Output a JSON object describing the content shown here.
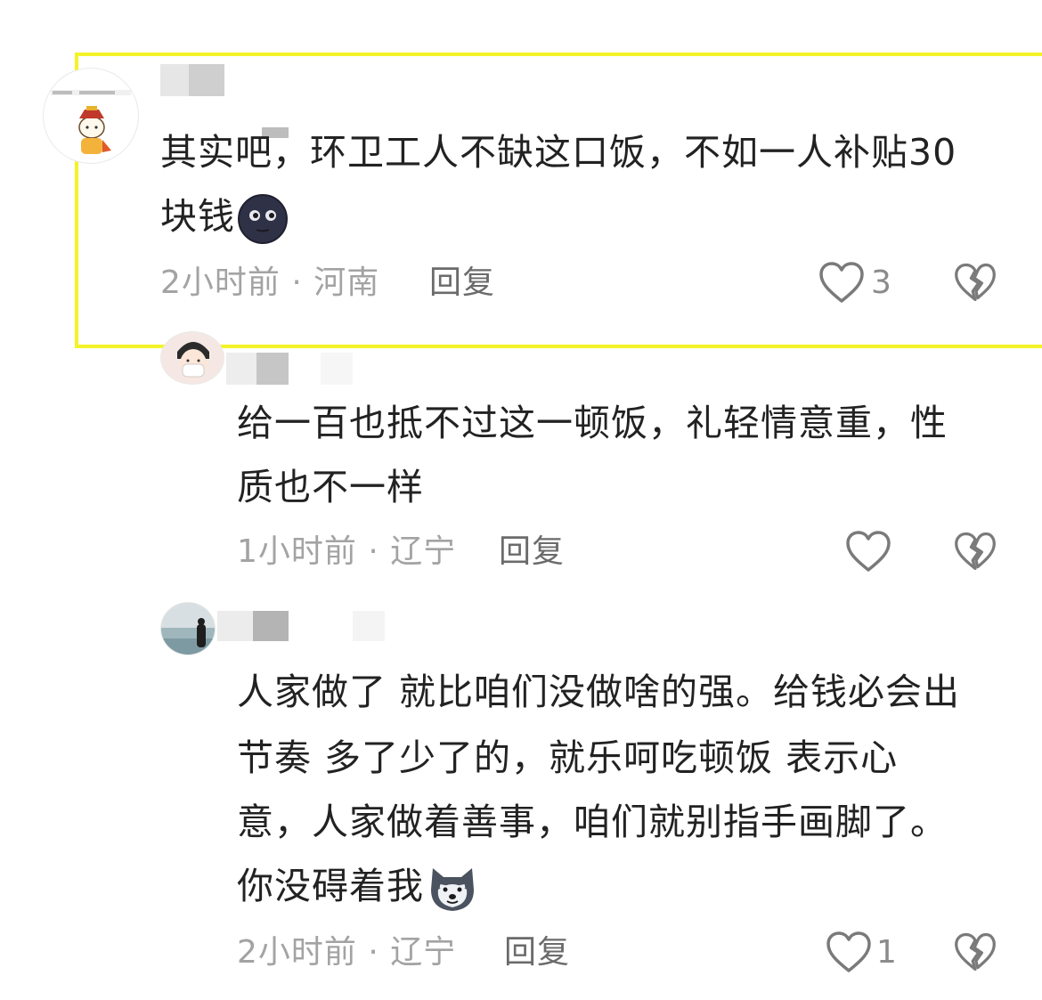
{
  "comments": [
    {
      "text_lines": [
        "其实吧，环卫工人不缺这口饭，不如一人补贴30",
        "块钱"
      ],
      "emoji": "new-moon-face-emoji",
      "time": "2小时前",
      "location": "河南",
      "reply_label": "回复",
      "likes": "3"
    },
    {
      "text_lines": [
        "给一百也抵不过这一顿饭，礼轻情意重，性",
        "质也不一样"
      ],
      "time": "1小时前",
      "location": "辽宁",
      "reply_label": "回复",
      "likes": ""
    },
    {
      "text_lines": [
        "人家做了 就比咱们没做啥的强。给钱必会出",
        "节奏 多了少了的，就乐呵吃顿饭 表示心",
        "意，人家做着善事，咱们就别指手画脚了。",
        "你没碍着我"
      ],
      "emoji": "doge-emoji",
      "time": "2小时前",
      "location": "辽宁",
      "reply_label": "回复",
      "likes": "1"
    }
  ],
  "separator": " · ",
  "colors": {
    "highlight": "#f3f328",
    "text": "#222222",
    "meta": "#a3a3a3",
    "reply": "#6b6b6b",
    "icon": "#7a7a7a"
  }
}
